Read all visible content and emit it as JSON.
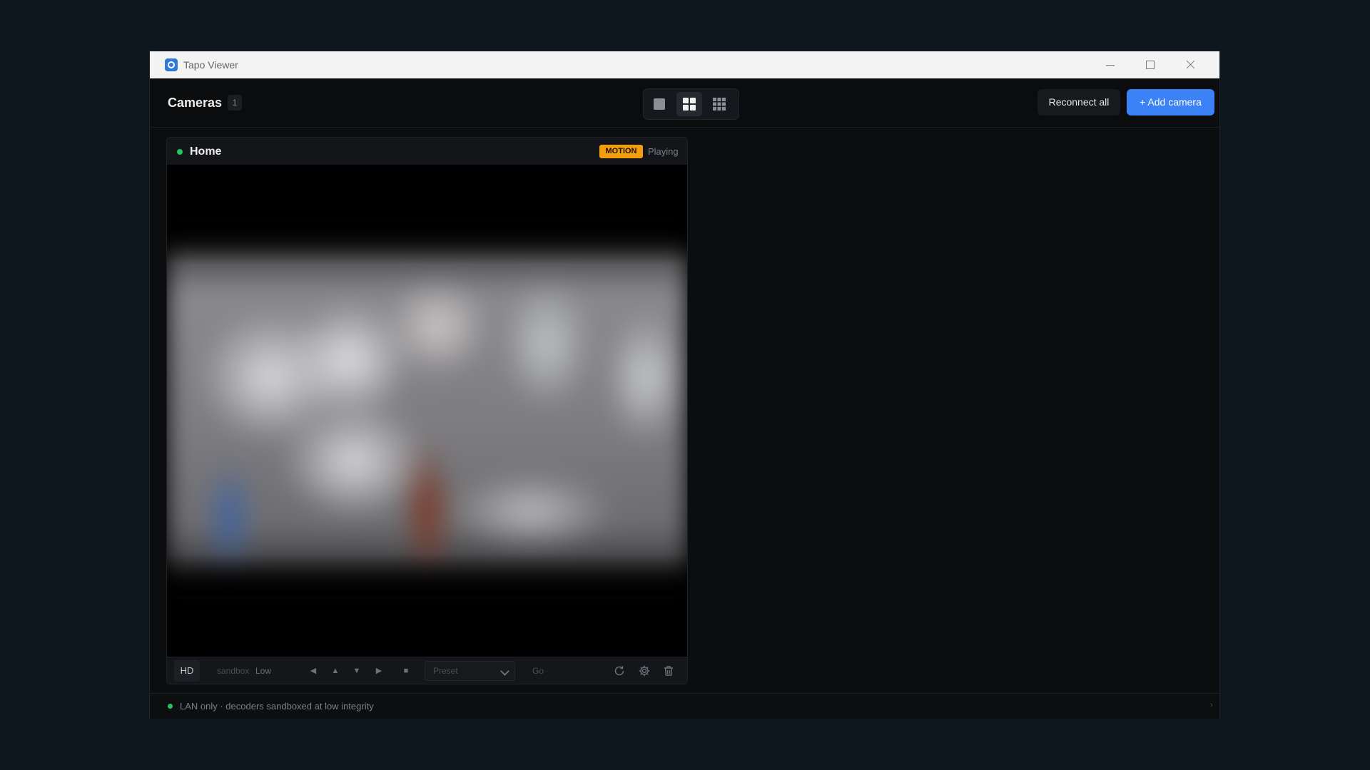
{
  "window": {
    "title": "Tapo Viewer"
  },
  "header": {
    "title": "Cameras",
    "count": "1",
    "layout_options": [
      "single",
      "grid-2x2",
      "grid-3x3"
    ],
    "active_layout": "grid-2x2",
    "reconnect_label": "Reconnect all",
    "add_label": "+ Add camera"
  },
  "camera": {
    "name": "Home",
    "online": true,
    "motion_badge": "MOTION",
    "state": "Playing",
    "controls": {
      "hd_label": "HD",
      "quality_prefix": "sandbox",
      "quality_value": "Low",
      "ptz": {
        "left": "◀",
        "up": "▲",
        "down": "▼",
        "right": "▶",
        "stop": "■"
      },
      "preset_placeholder": "Preset",
      "go_label": "Go",
      "icons": [
        "refresh-icon",
        "gear-icon",
        "trash-icon"
      ]
    }
  },
  "statusbar": {
    "text": "LAN only · decoders sandboxed at low integrity",
    "chevron": "›"
  },
  "colors": {
    "accent": "#3b82f6",
    "online": "#22c55e",
    "motion": "#f59e0b",
    "background": "#0c0d0f"
  }
}
